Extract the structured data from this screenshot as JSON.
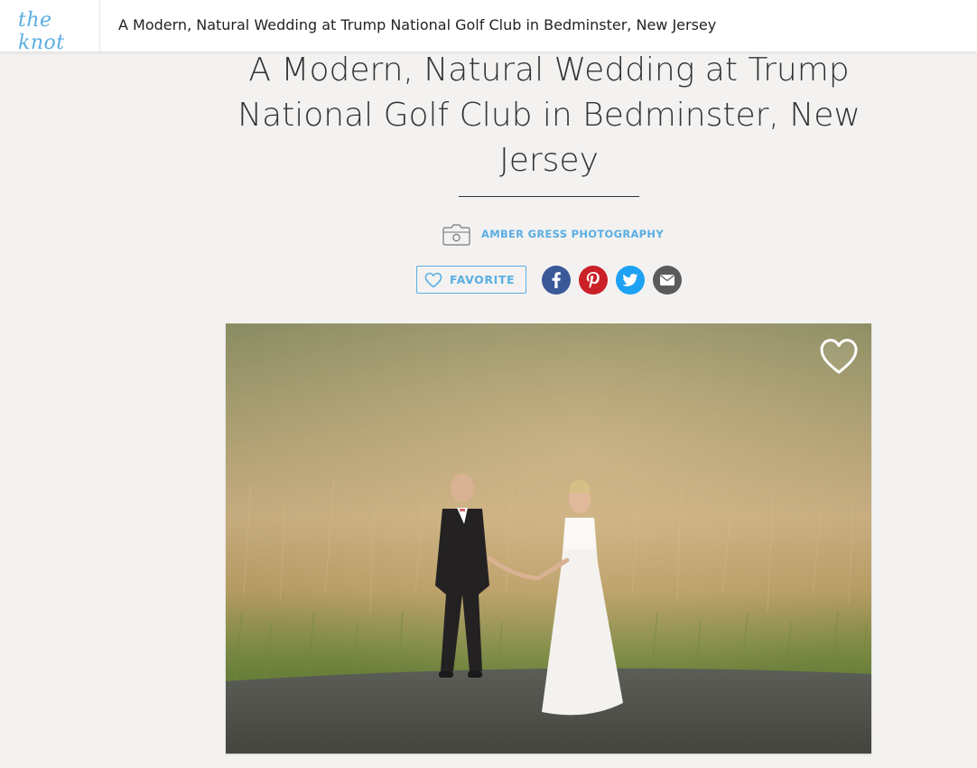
{
  "header": {
    "logo_text": "the knot",
    "title": "A Modern, Natural Wedding at Trump National Golf Club in Bedminster, New Jersey"
  },
  "article": {
    "headline_line1": "A Modern, Natural Wedding at Trump",
    "headline_line2": "National Golf Club in Bedminster, New",
    "headline_line3": "Jersey",
    "photo_credit": "AMBER GRESS PHOTOGRAPHY",
    "favorite_label": "FAVORITE"
  },
  "share": {
    "icons": [
      "facebook-icon",
      "pinterest-icon",
      "twitter-icon",
      "email-icon"
    ]
  },
  "colors": {
    "brand_blue": "#5aaee3",
    "facebook": "#3b5998",
    "pinterest": "#cb2027",
    "twitter": "#1da1f2",
    "email": "#5b5b5b",
    "background": "#f3f2f1"
  }
}
